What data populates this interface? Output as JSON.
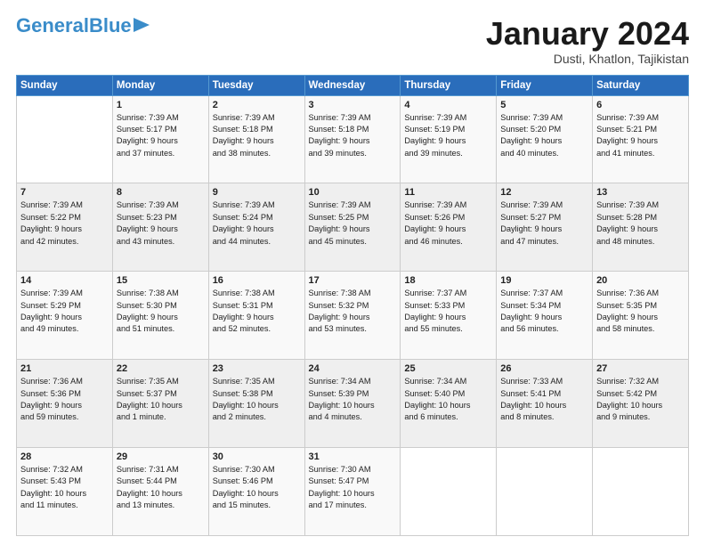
{
  "header": {
    "logo_line1": "General",
    "logo_line2": "Blue",
    "month_title": "January 2024",
    "location": "Dusti, Khatlon, Tajikistan"
  },
  "weekdays": [
    "Sunday",
    "Monday",
    "Tuesday",
    "Wednesday",
    "Thursday",
    "Friday",
    "Saturday"
  ],
  "weeks": [
    [
      {
        "num": "",
        "info": ""
      },
      {
        "num": "1",
        "info": "Sunrise: 7:39 AM\nSunset: 5:17 PM\nDaylight: 9 hours\nand 37 minutes."
      },
      {
        "num": "2",
        "info": "Sunrise: 7:39 AM\nSunset: 5:18 PM\nDaylight: 9 hours\nand 38 minutes."
      },
      {
        "num": "3",
        "info": "Sunrise: 7:39 AM\nSunset: 5:18 PM\nDaylight: 9 hours\nand 39 minutes."
      },
      {
        "num": "4",
        "info": "Sunrise: 7:39 AM\nSunset: 5:19 PM\nDaylight: 9 hours\nand 39 minutes."
      },
      {
        "num": "5",
        "info": "Sunrise: 7:39 AM\nSunset: 5:20 PM\nDaylight: 9 hours\nand 40 minutes."
      },
      {
        "num": "6",
        "info": "Sunrise: 7:39 AM\nSunset: 5:21 PM\nDaylight: 9 hours\nand 41 minutes."
      }
    ],
    [
      {
        "num": "7",
        "info": "Sunrise: 7:39 AM\nSunset: 5:22 PM\nDaylight: 9 hours\nand 42 minutes."
      },
      {
        "num": "8",
        "info": "Sunrise: 7:39 AM\nSunset: 5:23 PM\nDaylight: 9 hours\nand 43 minutes."
      },
      {
        "num": "9",
        "info": "Sunrise: 7:39 AM\nSunset: 5:24 PM\nDaylight: 9 hours\nand 44 minutes."
      },
      {
        "num": "10",
        "info": "Sunrise: 7:39 AM\nSunset: 5:25 PM\nDaylight: 9 hours\nand 45 minutes."
      },
      {
        "num": "11",
        "info": "Sunrise: 7:39 AM\nSunset: 5:26 PM\nDaylight: 9 hours\nand 46 minutes."
      },
      {
        "num": "12",
        "info": "Sunrise: 7:39 AM\nSunset: 5:27 PM\nDaylight: 9 hours\nand 47 minutes."
      },
      {
        "num": "13",
        "info": "Sunrise: 7:39 AM\nSunset: 5:28 PM\nDaylight: 9 hours\nand 48 minutes."
      }
    ],
    [
      {
        "num": "14",
        "info": "Sunrise: 7:39 AM\nSunset: 5:29 PM\nDaylight: 9 hours\nand 49 minutes."
      },
      {
        "num": "15",
        "info": "Sunrise: 7:38 AM\nSunset: 5:30 PM\nDaylight: 9 hours\nand 51 minutes."
      },
      {
        "num": "16",
        "info": "Sunrise: 7:38 AM\nSunset: 5:31 PM\nDaylight: 9 hours\nand 52 minutes."
      },
      {
        "num": "17",
        "info": "Sunrise: 7:38 AM\nSunset: 5:32 PM\nDaylight: 9 hours\nand 53 minutes."
      },
      {
        "num": "18",
        "info": "Sunrise: 7:37 AM\nSunset: 5:33 PM\nDaylight: 9 hours\nand 55 minutes."
      },
      {
        "num": "19",
        "info": "Sunrise: 7:37 AM\nSunset: 5:34 PM\nDaylight: 9 hours\nand 56 minutes."
      },
      {
        "num": "20",
        "info": "Sunrise: 7:36 AM\nSunset: 5:35 PM\nDaylight: 9 hours\nand 58 minutes."
      }
    ],
    [
      {
        "num": "21",
        "info": "Sunrise: 7:36 AM\nSunset: 5:36 PM\nDaylight: 9 hours\nand 59 minutes."
      },
      {
        "num": "22",
        "info": "Sunrise: 7:35 AM\nSunset: 5:37 PM\nDaylight: 10 hours\nand 1 minute."
      },
      {
        "num": "23",
        "info": "Sunrise: 7:35 AM\nSunset: 5:38 PM\nDaylight: 10 hours\nand 2 minutes."
      },
      {
        "num": "24",
        "info": "Sunrise: 7:34 AM\nSunset: 5:39 PM\nDaylight: 10 hours\nand 4 minutes."
      },
      {
        "num": "25",
        "info": "Sunrise: 7:34 AM\nSunset: 5:40 PM\nDaylight: 10 hours\nand 6 minutes."
      },
      {
        "num": "26",
        "info": "Sunrise: 7:33 AM\nSunset: 5:41 PM\nDaylight: 10 hours\nand 8 minutes."
      },
      {
        "num": "27",
        "info": "Sunrise: 7:32 AM\nSunset: 5:42 PM\nDaylight: 10 hours\nand 9 minutes."
      }
    ],
    [
      {
        "num": "28",
        "info": "Sunrise: 7:32 AM\nSunset: 5:43 PM\nDaylight: 10 hours\nand 11 minutes."
      },
      {
        "num": "29",
        "info": "Sunrise: 7:31 AM\nSunset: 5:44 PM\nDaylight: 10 hours\nand 13 minutes."
      },
      {
        "num": "30",
        "info": "Sunrise: 7:30 AM\nSunset: 5:46 PM\nDaylight: 10 hours\nand 15 minutes."
      },
      {
        "num": "31",
        "info": "Sunrise: 7:30 AM\nSunset: 5:47 PM\nDaylight: 10 hours\nand 17 minutes."
      },
      {
        "num": "",
        "info": ""
      },
      {
        "num": "",
        "info": ""
      },
      {
        "num": "",
        "info": ""
      }
    ]
  ]
}
